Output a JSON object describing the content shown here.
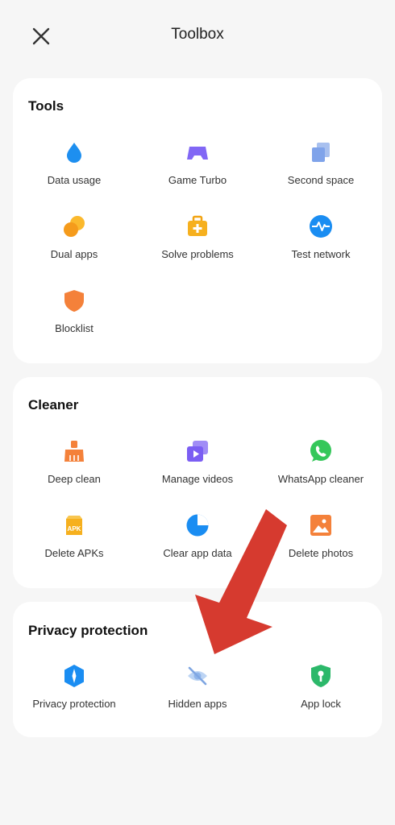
{
  "header": {
    "title": "Toolbox"
  },
  "sections": {
    "tools": {
      "title": "Tools",
      "items": [
        "Data usage",
        "Game Turbo",
        "Second space",
        "Dual apps",
        "Solve problems",
        "Test network",
        "Blocklist"
      ]
    },
    "cleaner": {
      "title": "Cleaner",
      "items": [
        "Deep clean",
        "Manage videos",
        "WhatsApp cleaner",
        "Delete APKs",
        "Clear app data",
        "Delete photos"
      ]
    },
    "privacy": {
      "title": "Privacy protection",
      "items": [
        "Privacy protection",
        "Hidden apps",
        "App lock"
      ]
    }
  },
  "icons": {
    "tools": [
      "water-drop-icon",
      "gamepad-icon",
      "second-space-icon",
      "dual-apps-icon",
      "first-aid-kit-icon",
      "pulse-icon",
      "shield-icon"
    ],
    "cleaner": [
      "broom-icon",
      "video-icon",
      "whatsapp-icon",
      "apk-icon",
      "pie-chart-icon",
      "photo-icon"
    ],
    "privacy": [
      "privacy-shield-icon",
      "hidden-eye-icon",
      "lock-shield-icon"
    ]
  },
  "apk_icon_text": "APK",
  "annotation": {
    "color": "#d63a2f"
  }
}
